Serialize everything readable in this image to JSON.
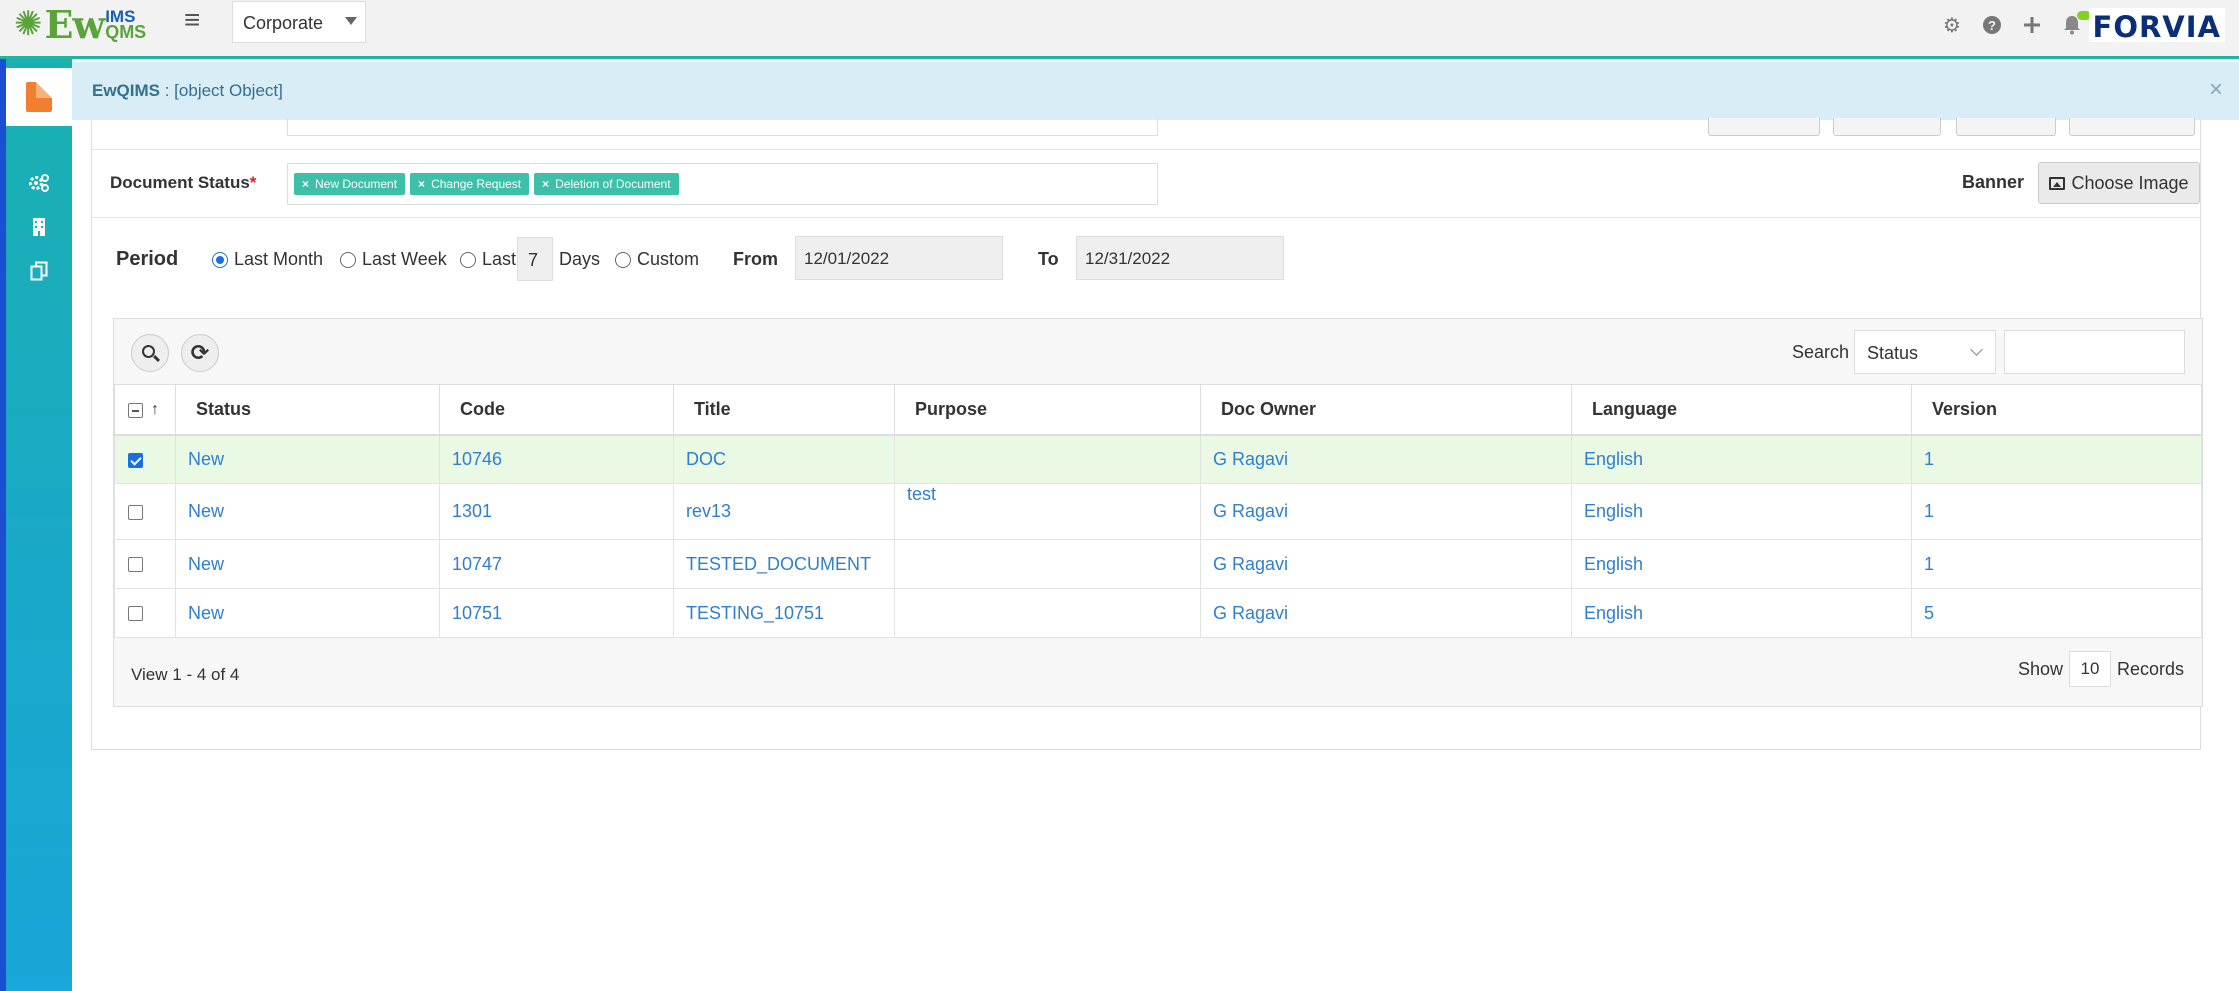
{
  "header": {
    "logo_main": "Ew",
    "logo_top": "IMS",
    "logo_bottom": "QMS",
    "org_select": "Corporate",
    "brand": "FORVIA"
  },
  "alert": {
    "app": "EwQIMS",
    "message": " : [object Object]",
    "close": "×"
  },
  "form": {
    "doc_status_label": "Document Status",
    "required_mark": "*",
    "tags": [
      "New Document",
      "Change Request",
      "Deletion of Document"
    ],
    "tag_remove": "×",
    "banner_label": "Banner",
    "choose_image": "Choose Image"
  },
  "period": {
    "label": "Period",
    "options": [
      "Last Month",
      "Last Week",
      "Last",
      "Custom"
    ],
    "selected": "Last Month",
    "days_value": "7",
    "days_label": "Days",
    "from_label": "From",
    "from_value": "12/01/2022",
    "to_label": "To",
    "to_value": "12/31/2022"
  },
  "grid": {
    "search_label": "Search",
    "search_field": "Status",
    "columns": [
      "Status",
      "Code",
      "Title",
      "Purpose",
      "Doc Owner",
      "Language",
      "Version"
    ],
    "rows": [
      {
        "selected": true,
        "status": "New",
        "code": "10746",
        "title": "DOC",
        "purpose": "",
        "owner": "G Ragavi",
        "language": "English",
        "version": "1"
      },
      {
        "selected": false,
        "status": "New",
        "code": "1301",
        "title": "rev13",
        "purpose": "test",
        "owner": "G Ragavi",
        "language": "English",
        "version": "1"
      },
      {
        "selected": false,
        "status": "New",
        "code": "10747",
        "title": "TESTED_DOCUMENT",
        "purpose": "",
        "owner": "G Ragavi",
        "language": "English",
        "version": "1"
      },
      {
        "selected": false,
        "status": "New",
        "code": "10751",
        "title": "TESTING_10751",
        "purpose": "",
        "owner": "G Ragavi",
        "language": "English",
        "version": "5"
      }
    ],
    "view_info": "View 1 - 4 of 4",
    "show_label": "Show",
    "page_size": "10",
    "records_label": "Records"
  },
  "colors": {
    "accent": "#1fb5a3",
    "tag": "#3dbfa8",
    "link": "#2f7fd1",
    "alert_bg": "#d9edf7",
    "selected_row": "#eaf9e4"
  },
  "icons": [
    "hamburger-icon",
    "gear-icon",
    "help-icon",
    "plus-icon",
    "bell-icon",
    "avatar",
    "document-icon",
    "settings-gears-icon",
    "building-icon",
    "copy-icon",
    "close-icon",
    "image-icon",
    "search-icon",
    "refresh-icon",
    "chevron-down-icon",
    "sort-arrow-icon"
  ]
}
